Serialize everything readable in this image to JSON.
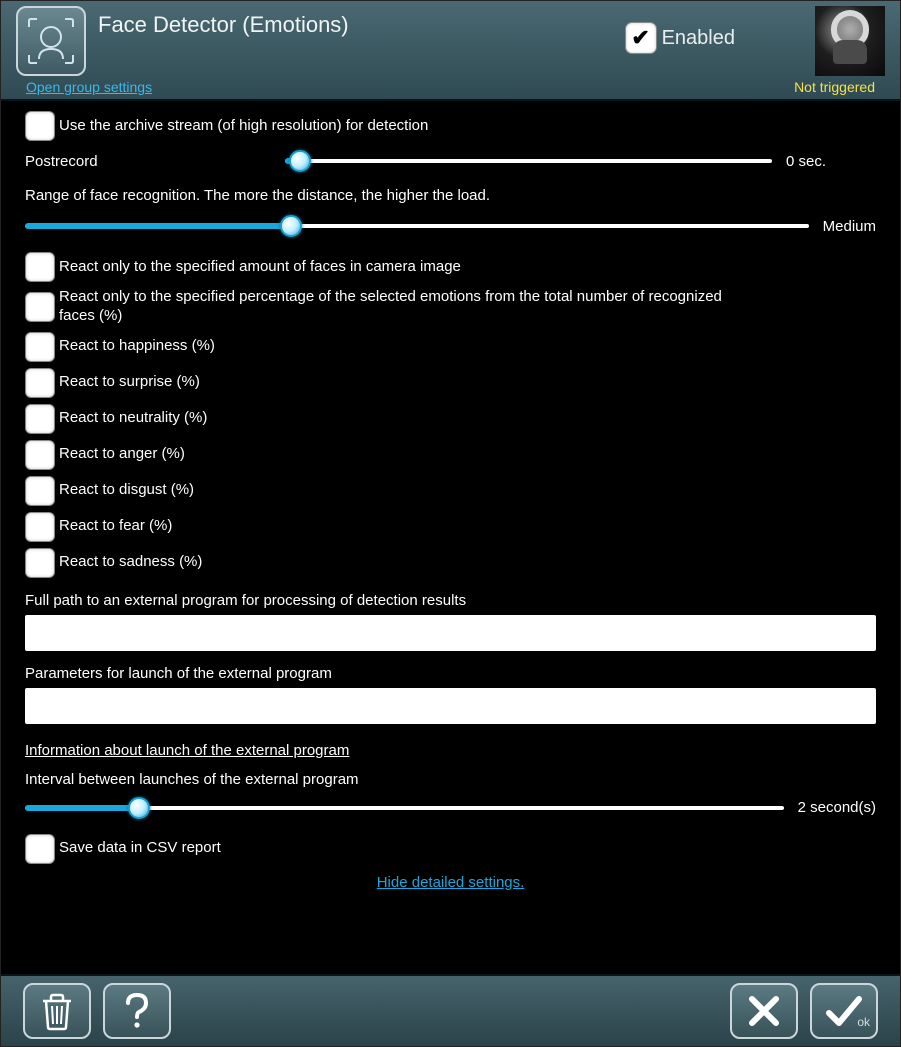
{
  "header": {
    "title": "Face Detector (Emotions)",
    "enabled_label": "Enabled",
    "enabled_checked": true,
    "group_link": "Open group settings",
    "status": "Not triggered"
  },
  "checks": {
    "archive_stream": {
      "label": "Use the archive stream (of high resolution) for detection",
      "checked": false
    },
    "react_amount": {
      "label": "React only to the specified amount of faces in camera image",
      "checked": false
    },
    "react_percent": {
      "label": "React only to the specified percentage of the selected emotions from the total number of recognized faces (%)",
      "checked": false
    },
    "happiness": {
      "label": "React to happiness (%)",
      "checked": false
    },
    "surprise": {
      "label": "React to surprise (%)",
      "checked": false
    },
    "neutrality": {
      "label": "React to neutrality (%)",
      "checked": false
    },
    "anger": {
      "label": "React to anger (%)",
      "checked": false
    },
    "disgust": {
      "label": "React to disgust (%)",
      "checked": false
    },
    "fear": {
      "label": "React to fear (%)",
      "checked": false
    },
    "sadness": {
      "label": "React to sadness (%)",
      "checked": false
    },
    "csv": {
      "label": "Save data in CSV report",
      "checked": false
    }
  },
  "sliders": {
    "postrecord": {
      "label": "Postrecord",
      "value_text": "0 sec.",
      "fill_pct": 3,
      "knob_pct": 3
    },
    "range_desc": "Range of face recognition. The more the distance, the higher the load.",
    "range": {
      "value_text": "Medium",
      "fill_pct": 34,
      "knob_pct": 34
    },
    "interval": {
      "label": "Interval between launches of the external program",
      "value_text": "2 second(s)",
      "fill_pct": 15,
      "knob_pct": 15
    }
  },
  "ext": {
    "path_label": "Full path to an external program for processing of detection results",
    "path_value": "",
    "params_label": "Parameters for launch of the external program",
    "params_value": "",
    "info_link": "Information about launch of the external program"
  },
  "hide_link": "Hide detailed settings.",
  "footer": {
    "ok_sub": "ok"
  }
}
